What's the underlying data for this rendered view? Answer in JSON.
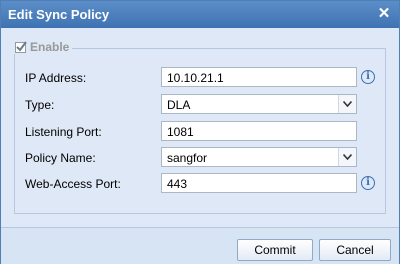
{
  "window": {
    "title": "Edit Sync Policy"
  },
  "enable": {
    "label": "Enable",
    "checked": true
  },
  "fields": {
    "ip_address": {
      "label": "IP Address:",
      "value": "10.10.21.1"
    },
    "type": {
      "label": "Type:",
      "value": "DLA"
    },
    "listening_port": {
      "label": "Listening Port:",
      "value": "1081"
    },
    "policy_name": {
      "label": "Policy Name:",
      "value": "sangfor"
    },
    "web_access_port": {
      "label": "Web-Access Port:",
      "value": "443"
    }
  },
  "buttons": {
    "commit": "Commit",
    "cancel": "Cancel"
  },
  "icons": {
    "close": "close-icon",
    "info": "info-icon",
    "dropdown": "chevron-down-icon"
  },
  "colors": {
    "titlebar": "#4a7fbf",
    "panel": "#dfe8f6",
    "info": "#3b6fb3"
  }
}
